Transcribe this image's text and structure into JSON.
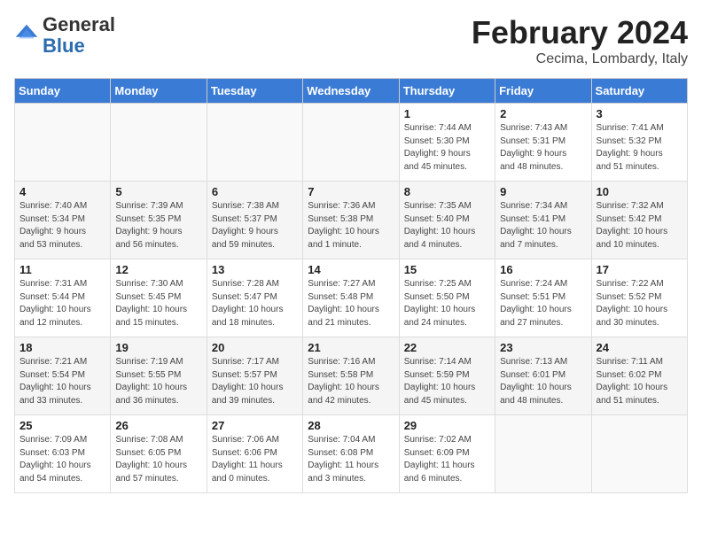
{
  "header": {
    "logo_general": "General",
    "logo_blue": "Blue",
    "month_year": "February 2024",
    "location": "Cecima, Lombardy, Italy"
  },
  "days_of_week": [
    "Sunday",
    "Monday",
    "Tuesday",
    "Wednesday",
    "Thursday",
    "Friday",
    "Saturday"
  ],
  "weeks": [
    [
      {
        "day": "",
        "info": ""
      },
      {
        "day": "",
        "info": ""
      },
      {
        "day": "",
        "info": ""
      },
      {
        "day": "",
        "info": ""
      },
      {
        "day": "1",
        "info": "Sunrise: 7:44 AM\nSunset: 5:30 PM\nDaylight: 9 hours\nand 45 minutes."
      },
      {
        "day": "2",
        "info": "Sunrise: 7:43 AM\nSunset: 5:31 PM\nDaylight: 9 hours\nand 48 minutes."
      },
      {
        "day": "3",
        "info": "Sunrise: 7:41 AM\nSunset: 5:32 PM\nDaylight: 9 hours\nand 51 minutes."
      }
    ],
    [
      {
        "day": "4",
        "info": "Sunrise: 7:40 AM\nSunset: 5:34 PM\nDaylight: 9 hours\nand 53 minutes."
      },
      {
        "day": "5",
        "info": "Sunrise: 7:39 AM\nSunset: 5:35 PM\nDaylight: 9 hours\nand 56 minutes."
      },
      {
        "day": "6",
        "info": "Sunrise: 7:38 AM\nSunset: 5:37 PM\nDaylight: 9 hours\nand 59 minutes."
      },
      {
        "day": "7",
        "info": "Sunrise: 7:36 AM\nSunset: 5:38 PM\nDaylight: 10 hours\nand 1 minute."
      },
      {
        "day": "8",
        "info": "Sunrise: 7:35 AM\nSunset: 5:40 PM\nDaylight: 10 hours\nand 4 minutes."
      },
      {
        "day": "9",
        "info": "Sunrise: 7:34 AM\nSunset: 5:41 PM\nDaylight: 10 hours\nand 7 minutes."
      },
      {
        "day": "10",
        "info": "Sunrise: 7:32 AM\nSunset: 5:42 PM\nDaylight: 10 hours\nand 10 minutes."
      }
    ],
    [
      {
        "day": "11",
        "info": "Sunrise: 7:31 AM\nSunset: 5:44 PM\nDaylight: 10 hours\nand 12 minutes."
      },
      {
        "day": "12",
        "info": "Sunrise: 7:30 AM\nSunset: 5:45 PM\nDaylight: 10 hours\nand 15 minutes."
      },
      {
        "day": "13",
        "info": "Sunrise: 7:28 AM\nSunset: 5:47 PM\nDaylight: 10 hours\nand 18 minutes."
      },
      {
        "day": "14",
        "info": "Sunrise: 7:27 AM\nSunset: 5:48 PM\nDaylight: 10 hours\nand 21 minutes."
      },
      {
        "day": "15",
        "info": "Sunrise: 7:25 AM\nSunset: 5:50 PM\nDaylight: 10 hours\nand 24 minutes."
      },
      {
        "day": "16",
        "info": "Sunrise: 7:24 AM\nSunset: 5:51 PM\nDaylight: 10 hours\nand 27 minutes."
      },
      {
        "day": "17",
        "info": "Sunrise: 7:22 AM\nSunset: 5:52 PM\nDaylight: 10 hours\nand 30 minutes."
      }
    ],
    [
      {
        "day": "18",
        "info": "Sunrise: 7:21 AM\nSunset: 5:54 PM\nDaylight: 10 hours\nand 33 minutes."
      },
      {
        "day": "19",
        "info": "Sunrise: 7:19 AM\nSunset: 5:55 PM\nDaylight: 10 hours\nand 36 minutes."
      },
      {
        "day": "20",
        "info": "Sunrise: 7:17 AM\nSunset: 5:57 PM\nDaylight: 10 hours\nand 39 minutes."
      },
      {
        "day": "21",
        "info": "Sunrise: 7:16 AM\nSunset: 5:58 PM\nDaylight: 10 hours\nand 42 minutes."
      },
      {
        "day": "22",
        "info": "Sunrise: 7:14 AM\nSunset: 5:59 PM\nDaylight: 10 hours\nand 45 minutes."
      },
      {
        "day": "23",
        "info": "Sunrise: 7:13 AM\nSunset: 6:01 PM\nDaylight: 10 hours\nand 48 minutes."
      },
      {
        "day": "24",
        "info": "Sunrise: 7:11 AM\nSunset: 6:02 PM\nDaylight: 10 hours\nand 51 minutes."
      }
    ],
    [
      {
        "day": "25",
        "info": "Sunrise: 7:09 AM\nSunset: 6:03 PM\nDaylight: 10 hours\nand 54 minutes."
      },
      {
        "day": "26",
        "info": "Sunrise: 7:08 AM\nSunset: 6:05 PM\nDaylight: 10 hours\nand 57 minutes."
      },
      {
        "day": "27",
        "info": "Sunrise: 7:06 AM\nSunset: 6:06 PM\nDaylight: 11 hours\nand 0 minutes."
      },
      {
        "day": "28",
        "info": "Sunrise: 7:04 AM\nSunset: 6:08 PM\nDaylight: 11 hours\nand 3 minutes."
      },
      {
        "day": "29",
        "info": "Sunrise: 7:02 AM\nSunset: 6:09 PM\nDaylight: 11 hours\nand 6 minutes."
      },
      {
        "day": "",
        "info": ""
      },
      {
        "day": "",
        "info": ""
      }
    ]
  ]
}
